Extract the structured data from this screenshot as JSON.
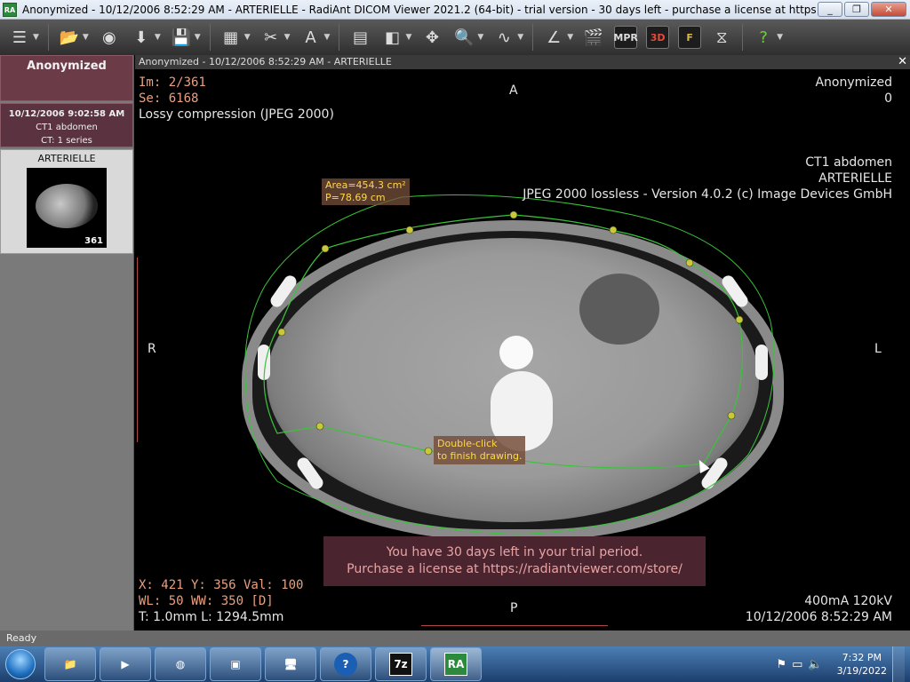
{
  "window": {
    "title": "Anonymized - 10/12/2006 8:52:29 AM - ARTERIELLE - RadiAnt DICOM Viewer 2021.2 (64-bit) - trial version - 30 days left - purchase a license at https://radiantviewer.com...",
    "app_icon": "RA",
    "minimize": "_",
    "maximize": "❐",
    "close": "✕"
  },
  "toolbar": {
    "tools": [
      {
        "icon": "menu-icon",
        "glyph": "☰"
      },
      {
        "icon": "open-folder-icon",
        "glyph": "📂"
      },
      {
        "icon": "cd-dvd-icon",
        "glyph": "◉"
      },
      {
        "icon": "download-icon",
        "glyph": "⬇"
      },
      {
        "icon": "save-icon",
        "glyph": "💾"
      },
      {
        "icon": "layout-icon",
        "glyph": "▦"
      },
      {
        "icon": "tools-icon",
        "glyph": "✂"
      },
      {
        "icon": "text-icon",
        "glyph": "A"
      },
      {
        "icon": "series-stack-icon",
        "glyph": "▤"
      },
      {
        "icon": "window-level-icon",
        "glyph": "◧"
      },
      {
        "icon": "pan-icon",
        "glyph": "✥"
      },
      {
        "icon": "zoom-icon",
        "glyph": "🔍"
      },
      {
        "icon": "freehand-roi-icon",
        "glyph": "∿"
      },
      {
        "icon": "angle-icon",
        "glyph": "∠"
      },
      {
        "icon": "cine-icon",
        "glyph": "🎬"
      },
      {
        "icon": "mpr-icon",
        "glyph": "MPR"
      },
      {
        "icon": "3d-icon",
        "glyph": "3D"
      },
      {
        "icon": "fusion-icon",
        "glyph": "F"
      },
      {
        "icon": "compare-icon",
        "glyph": "⧖"
      },
      {
        "icon": "help-icon",
        "glyph": "?"
      }
    ]
  },
  "left": {
    "patient_name": "Anonymized",
    "study_date": "10/12/2006 9:02:58 AM",
    "study_desc": "CT1 abdomen",
    "study_series": "CT: 1 series",
    "series_name": "ARTERIELLE",
    "series_count": "361"
  },
  "viewer": {
    "header": "Anonymized - 10/12/2006 8:52:29 AM - ARTERIELLE",
    "close": "✕",
    "tl": [
      "Im: 2/361",
      "Se: 6168",
      "Lossy compression (JPEG 2000)"
    ],
    "tr": [
      "Anonymized",
      "0"
    ],
    "tr2": [
      "CT1 abdomen",
      "ARTERIELLE",
      "JPEG 2000 lossless - Version 4.0.2 (c) Image Devices GmbH"
    ],
    "bl": [
      "X: 421 Y: 356 Val: 100",
      "WL: 50 WW: 350 [D]",
      "T: 1.0mm L: 1294.5mm"
    ],
    "br": [
      "400mA 120kV",
      "10/12/2006 8:52:29 AM"
    ],
    "orient": {
      "top": "A",
      "bottom": "P",
      "left": "R",
      "right": "L"
    },
    "measure": [
      "Area=454.3 cm²",
      "P=78.69 cm"
    ],
    "hint": [
      "Double-click",
      "to finish drawing."
    ],
    "trial": [
      "You have 30 days left in your trial period.",
      "Purchase a license at https://radiantviewer.com/store/"
    ]
  },
  "status": "Ready",
  "taskbar": {
    "items": [
      {
        "icon": "explorer-icon",
        "glyph": "📁"
      },
      {
        "icon": "media-player-icon",
        "glyph": "▶"
      },
      {
        "icon": "chrome-icon",
        "glyph": "◍"
      },
      {
        "icon": "control-panel-icon",
        "glyph": "▣"
      },
      {
        "icon": "monitor-icon",
        "glyph": "🖥"
      },
      {
        "icon": "help-icon",
        "glyph": "?"
      },
      {
        "icon": "7zip-icon",
        "glyph": "7z"
      },
      {
        "icon": "radiant-icon",
        "glyph": "RA"
      }
    ],
    "time": "7:32 PM",
    "date": "3/19/2022"
  }
}
